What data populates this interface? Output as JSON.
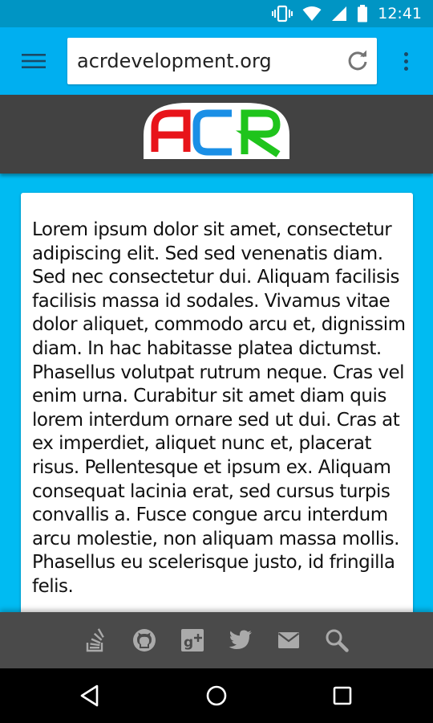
{
  "status_bar": {
    "time": "12:41",
    "icons": [
      "vibrate-icon",
      "wifi-icon",
      "signal-icon",
      "battery-icon"
    ]
  },
  "toolbar": {
    "url": "acrdevelopment.org",
    "icons": [
      "hamburger-menu-icon",
      "reload-icon",
      "overflow-menu-icon"
    ]
  },
  "logo": {
    "letters": [
      "A",
      "C",
      "R"
    ],
    "colors": [
      "#e8141a",
      "#1a8fe6",
      "#1fc41c"
    ]
  },
  "content": {
    "text": "Lorem ipsum dolor sit amet, consectetur adipiscing elit. Sed sed venenatis diam. Sed nec consectetur dui. Aliquam facilisis facilisis massa id sodales. Vivamus vitae dolor aliquet, commodo arcu et, dignissim diam. In hac habitasse platea dictumst. Phasellus volutpat rutrum neque. Cras vel enim urna. Curabitur sit amet diam quis lorem interdum ornare sed ut dui. Cras at ex imperdiet, aliquet nunc et, placerat risus. Pellentesque et ipsum ex. Aliquam consequat lacinia erat, sed cursus turpis convallis a. Fusce congue arcu interdum arcu molestie, non aliquam massa mollis. Phasellus eu scelerisque justo, id fringilla felis."
  },
  "social_bar": {
    "icons": [
      "stackoverflow-icon",
      "github-icon",
      "google-plus-icon",
      "twitter-icon",
      "email-icon",
      "search-icon"
    ]
  },
  "nav_bar": {
    "icons": [
      "back-icon",
      "home-icon",
      "recents-icon"
    ]
  },
  "colors": {
    "status_bar": "#0095c4",
    "toolbar": "#00aff0",
    "page_background": "#00bbf2",
    "logo_band": "#424242",
    "social_bar": "#4a4a4a"
  }
}
